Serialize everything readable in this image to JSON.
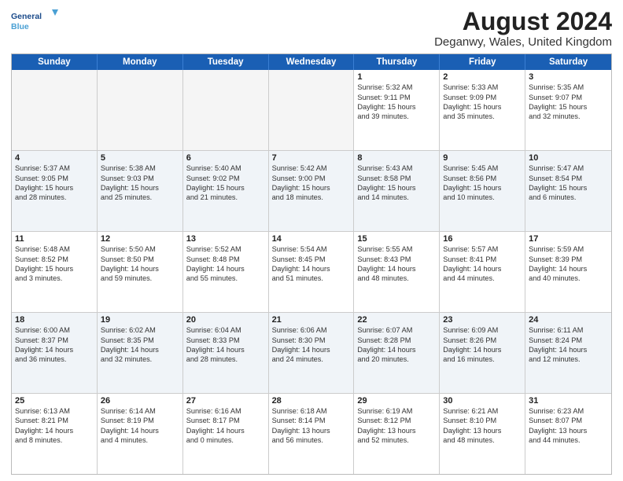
{
  "logo": {
    "line1": "General",
    "line2": "Blue"
  },
  "title": "August 2024",
  "subtitle": "Deganwy, Wales, United Kingdom",
  "days": [
    "Sunday",
    "Monday",
    "Tuesday",
    "Wednesday",
    "Thursday",
    "Friday",
    "Saturday"
  ],
  "rows": [
    [
      {
        "num": "",
        "lines": [],
        "empty": true
      },
      {
        "num": "",
        "lines": [],
        "empty": true
      },
      {
        "num": "",
        "lines": [],
        "empty": true
      },
      {
        "num": "",
        "lines": [],
        "empty": true
      },
      {
        "num": "1",
        "lines": [
          "Sunrise: 5:32 AM",
          "Sunset: 9:11 PM",
          "Daylight: 15 hours",
          "and 39 minutes."
        ]
      },
      {
        "num": "2",
        "lines": [
          "Sunrise: 5:33 AM",
          "Sunset: 9:09 PM",
          "Daylight: 15 hours",
          "and 35 minutes."
        ]
      },
      {
        "num": "3",
        "lines": [
          "Sunrise: 5:35 AM",
          "Sunset: 9:07 PM",
          "Daylight: 15 hours",
          "and 32 minutes."
        ]
      }
    ],
    [
      {
        "num": "4",
        "lines": [
          "Sunrise: 5:37 AM",
          "Sunset: 9:05 PM",
          "Daylight: 15 hours",
          "and 28 minutes."
        ]
      },
      {
        "num": "5",
        "lines": [
          "Sunrise: 5:38 AM",
          "Sunset: 9:03 PM",
          "Daylight: 15 hours",
          "and 25 minutes."
        ]
      },
      {
        "num": "6",
        "lines": [
          "Sunrise: 5:40 AM",
          "Sunset: 9:02 PM",
          "Daylight: 15 hours",
          "and 21 minutes."
        ]
      },
      {
        "num": "7",
        "lines": [
          "Sunrise: 5:42 AM",
          "Sunset: 9:00 PM",
          "Daylight: 15 hours",
          "and 18 minutes."
        ]
      },
      {
        "num": "8",
        "lines": [
          "Sunrise: 5:43 AM",
          "Sunset: 8:58 PM",
          "Daylight: 15 hours",
          "and 14 minutes."
        ]
      },
      {
        "num": "9",
        "lines": [
          "Sunrise: 5:45 AM",
          "Sunset: 8:56 PM",
          "Daylight: 15 hours",
          "and 10 minutes."
        ]
      },
      {
        "num": "10",
        "lines": [
          "Sunrise: 5:47 AM",
          "Sunset: 8:54 PM",
          "Daylight: 15 hours",
          "and 6 minutes."
        ]
      }
    ],
    [
      {
        "num": "11",
        "lines": [
          "Sunrise: 5:48 AM",
          "Sunset: 8:52 PM",
          "Daylight: 15 hours",
          "and 3 minutes."
        ]
      },
      {
        "num": "12",
        "lines": [
          "Sunrise: 5:50 AM",
          "Sunset: 8:50 PM",
          "Daylight: 14 hours",
          "and 59 minutes."
        ]
      },
      {
        "num": "13",
        "lines": [
          "Sunrise: 5:52 AM",
          "Sunset: 8:48 PM",
          "Daylight: 14 hours",
          "and 55 minutes."
        ]
      },
      {
        "num": "14",
        "lines": [
          "Sunrise: 5:54 AM",
          "Sunset: 8:45 PM",
          "Daylight: 14 hours",
          "and 51 minutes."
        ]
      },
      {
        "num": "15",
        "lines": [
          "Sunrise: 5:55 AM",
          "Sunset: 8:43 PM",
          "Daylight: 14 hours",
          "and 48 minutes."
        ]
      },
      {
        "num": "16",
        "lines": [
          "Sunrise: 5:57 AM",
          "Sunset: 8:41 PM",
          "Daylight: 14 hours",
          "and 44 minutes."
        ]
      },
      {
        "num": "17",
        "lines": [
          "Sunrise: 5:59 AM",
          "Sunset: 8:39 PM",
          "Daylight: 14 hours",
          "and 40 minutes."
        ]
      }
    ],
    [
      {
        "num": "18",
        "lines": [
          "Sunrise: 6:00 AM",
          "Sunset: 8:37 PM",
          "Daylight: 14 hours",
          "and 36 minutes."
        ]
      },
      {
        "num": "19",
        "lines": [
          "Sunrise: 6:02 AM",
          "Sunset: 8:35 PM",
          "Daylight: 14 hours",
          "and 32 minutes."
        ]
      },
      {
        "num": "20",
        "lines": [
          "Sunrise: 6:04 AM",
          "Sunset: 8:33 PM",
          "Daylight: 14 hours",
          "and 28 minutes."
        ]
      },
      {
        "num": "21",
        "lines": [
          "Sunrise: 6:06 AM",
          "Sunset: 8:30 PM",
          "Daylight: 14 hours",
          "and 24 minutes."
        ]
      },
      {
        "num": "22",
        "lines": [
          "Sunrise: 6:07 AM",
          "Sunset: 8:28 PM",
          "Daylight: 14 hours",
          "and 20 minutes."
        ]
      },
      {
        "num": "23",
        "lines": [
          "Sunrise: 6:09 AM",
          "Sunset: 8:26 PM",
          "Daylight: 14 hours",
          "and 16 minutes."
        ]
      },
      {
        "num": "24",
        "lines": [
          "Sunrise: 6:11 AM",
          "Sunset: 8:24 PM",
          "Daylight: 14 hours",
          "and 12 minutes."
        ]
      }
    ],
    [
      {
        "num": "25",
        "lines": [
          "Sunrise: 6:13 AM",
          "Sunset: 8:21 PM",
          "Daylight: 14 hours",
          "and 8 minutes."
        ]
      },
      {
        "num": "26",
        "lines": [
          "Sunrise: 6:14 AM",
          "Sunset: 8:19 PM",
          "Daylight: 14 hours",
          "and 4 minutes."
        ]
      },
      {
        "num": "27",
        "lines": [
          "Sunrise: 6:16 AM",
          "Sunset: 8:17 PM",
          "Daylight: 14 hours",
          "and 0 minutes."
        ]
      },
      {
        "num": "28",
        "lines": [
          "Sunrise: 6:18 AM",
          "Sunset: 8:14 PM",
          "Daylight: 13 hours",
          "and 56 minutes."
        ]
      },
      {
        "num": "29",
        "lines": [
          "Sunrise: 6:19 AM",
          "Sunset: 8:12 PM",
          "Daylight: 13 hours",
          "and 52 minutes."
        ]
      },
      {
        "num": "30",
        "lines": [
          "Sunrise: 6:21 AM",
          "Sunset: 8:10 PM",
          "Daylight: 13 hours",
          "and 48 minutes."
        ]
      },
      {
        "num": "31",
        "lines": [
          "Sunrise: 6:23 AM",
          "Sunset: 8:07 PM",
          "Daylight: 13 hours",
          "and 44 minutes."
        ]
      }
    ]
  ]
}
